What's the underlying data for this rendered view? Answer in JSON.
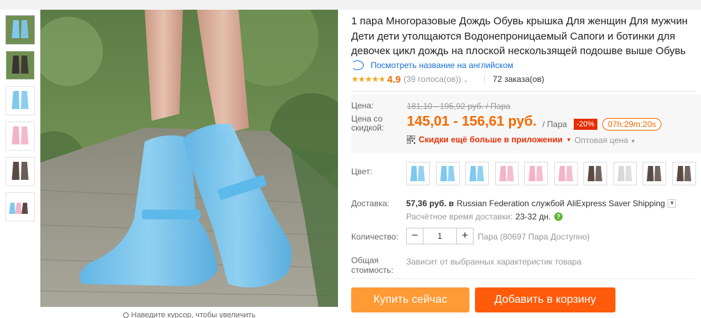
{
  "product": {
    "title": "1 пара Многоразовые Дождь Обувь крышка Для женщин Для мужчин Дети дети утолщаются Водонепроницаемый Сапоги и ботинки для девочек цикл дождь на плоской нескользящей подошве выше Обувь",
    "translate_link": "Посмотреть название на английском",
    "rating": "4.9",
    "votes": "(39 голоса(ов))",
    "orders": "72 заказа(ов)"
  },
  "gallery": {
    "thumbs": [
      "blue-boot",
      "black-boot",
      "blue-boot",
      "pink-boot",
      "brown-boot",
      "multi-boot"
    ],
    "hint": "Наведите курсор, чтобы увеличить"
  },
  "price": {
    "label": "Цена:",
    "old": "181,10 - 195,92 руб. / Пара",
    "discount_label": "Цена со скидкой:",
    "current": "145,01 - 156,61 руб.",
    "unit": "/ Пара",
    "discount": "-20%",
    "timer": "07h:29m:20s",
    "app_deal": "Скидки ещё больше в приложении",
    "wholesale": "Оптовая цена"
  },
  "color": {
    "label": "Цвет:",
    "swatches": [
      "#7fc8ee",
      "#7fc8ee",
      "#7fc8ee",
      "#f2b3c8",
      "#f2b3c8",
      "#f2b3c8",
      "#5a4a44",
      "#d8d8d8",
      "#5a4a44",
      "#5a4a44"
    ]
  },
  "shipping": {
    "label": "Доставка:",
    "price": "57,36 руб. в",
    "text": "Russian Federation службой AliExpress Saver Shipping",
    "time_label": "Расчётное время доставки:",
    "days": "23-32 дн."
  },
  "quantity": {
    "label": "Количество:",
    "value": "1",
    "available": "Пара (80697 Пара Доступно)"
  },
  "total": {
    "label": "Общая стоимость:",
    "value": "Зависит от выбранных характеристик товара"
  },
  "buttons": {
    "buy": "Купить сейчас",
    "cart": "Добавить в корзину"
  },
  "colors": {
    "accent": "#f56a00",
    "buy_button": "#ff9a34",
    "cart_button": "#ff5b0a",
    "link": "#1a6fd6",
    "deal_red": "#e62e04"
  }
}
